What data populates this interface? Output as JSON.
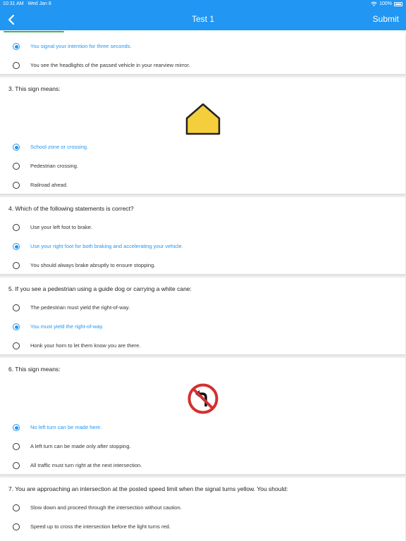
{
  "status": {
    "time": "10:31 AM",
    "date": "Wed Jan 8",
    "battery": "100%"
  },
  "header": {
    "title": "Test 1",
    "submit_label": "Submit",
    "progress_fraction": 0.15
  },
  "colors": {
    "accent": "#2196f3",
    "progress": "#4caf50"
  },
  "q2": {
    "options": [
      {
        "text": "You signal your intention for three seconds.",
        "selected": true
      },
      {
        "text": "You see the headlights of the passed vehicle in your rearview mirror.",
        "selected": false
      }
    ]
  },
  "q3": {
    "text": "3. This sign means:",
    "sign": "school-zone-sign-icon",
    "options": [
      {
        "text": "School zone or crossing.",
        "selected": true
      },
      {
        "text": "Pedestrian crossing.",
        "selected": false
      },
      {
        "text": "Railroad ahead.",
        "selected": false
      }
    ]
  },
  "q4": {
    "text": "4. Which of the following statements is correct?",
    "options": [
      {
        "text": "Use your left foot to brake.",
        "selected": false
      },
      {
        "text": "Use your right foot for both braking and accelerating your vehicle.",
        "selected": true
      },
      {
        "text": "You should always brake abruptly to ensure stopping.",
        "selected": false
      }
    ]
  },
  "q5": {
    "text": "5. If you see a pedestrian using a guide dog or carrying a white cane:",
    "options": [
      {
        "text": "The pedestrian must yield the right-of-way.",
        "selected": false
      },
      {
        "text": "You must yield the right-of-way.",
        "selected": true
      },
      {
        "text": "Honk your horn to let them know you are there.",
        "selected": false
      }
    ]
  },
  "q6": {
    "text": "6. This sign means:",
    "sign": "no-left-turn-sign-icon",
    "options": [
      {
        "text": "No left turn can be made here.",
        "selected": true
      },
      {
        "text": "A left turn can be made only after stopping.",
        "selected": false
      },
      {
        "text": "All traffic must turn right at the next intersection.",
        "selected": false
      }
    ]
  },
  "q7": {
    "text": "7. You are approaching an intersection at the posted speed limit when the signal turns yellow. You should:",
    "options": [
      {
        "text": "Slow down and proceed through the intersection without caution.",
        "selected": false
      },
      {
        "text": "Speed up to cross the intersection before the light turns red.",
        "selected": false
      }
    ]
  }
}
